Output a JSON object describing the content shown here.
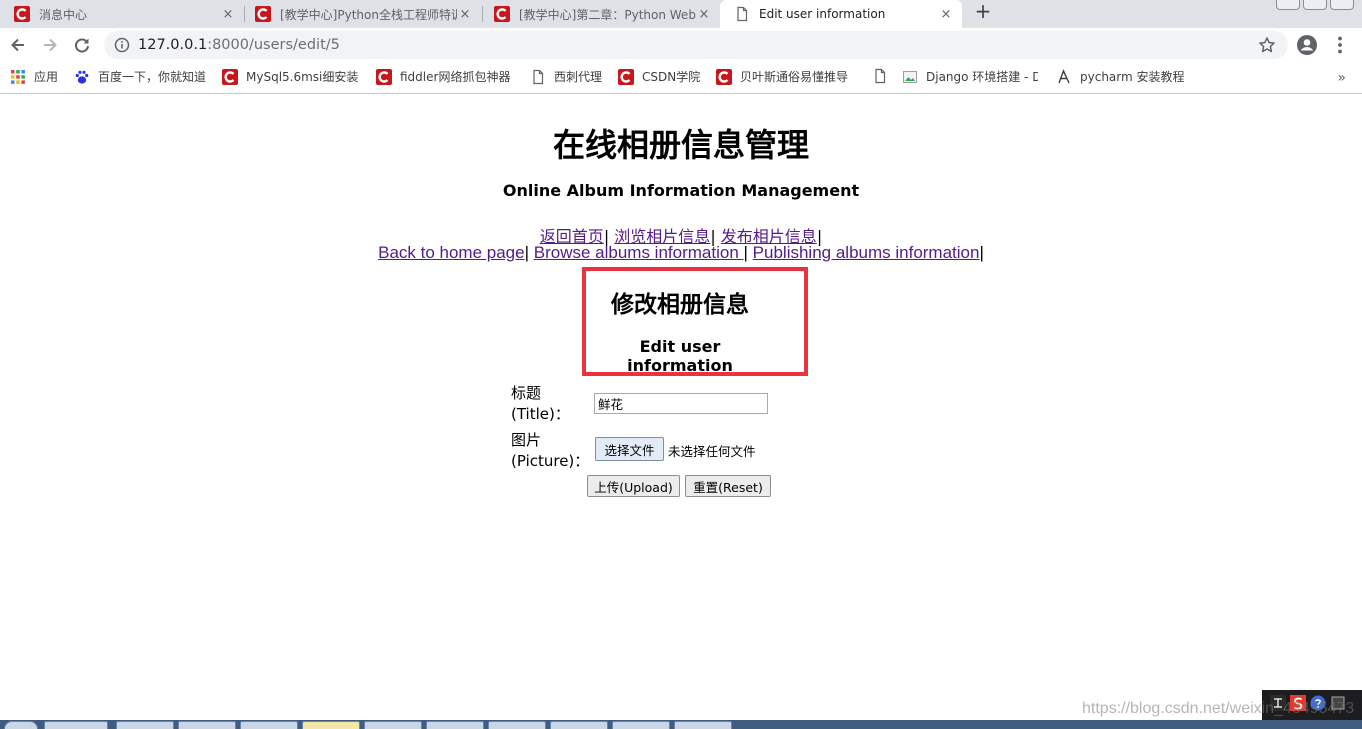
{
  "browser": {
    "tabs": [
      {
        "title": "消息中心",
        "close": "×",
        "icon": "csdn-c-icon"
      },
      {
        "title": "[教学中心]Python全栈工程师特训",
        "close": "×",
        "icon": "csdn-c-icon"
      },
      {
        "title": "[教学中心]第二章：Python Web",
        "close": "×",
        "icon": "csdn-c-icon"
      },
      {
        "title": "Edit user information",
        "close": "×",
        "icon": "document-icon"
      }
    ],
    "new_tab": "+",
    "url_host": "127.0.0.1",
    "url_path": ":8000/users/edit/5",
    "bookmarks": [
      {
        "label": "应用",
        "icon": "apps-grid-icon"
      },
      {
        "label": "百度一下，你就知道",
        "icon": "baidu-paw-icon"
      },
      {
        "label": "MySql5.6msi细安装",
        "icon": "csdn-c-icon"
      },
      {
        "label": "fiddler网络抓包神器",
        "icon": "csdn-c-icon"
      },
      {
        "label": "西刺代理",
        "icon": "document-icon"
      },
      {
        "label": "CSDN学院",
        "icon": "csdn-c-icon"
      },
      {
        "label": "贝叶斯通俗易懂推导",
        "icon": "csdn-c-icon"
      },
      {
        "label": "",
        "icon": "document-icon"
      },
      {
        "label": "Django 环境搭建 - D",
        "icon": "image-icon"
      },
      {
        "label": "pycharm 安装教程",
        "icon": "pycharm-icon"
      }
    ],
    "bookmarks_more": "»"
  },
  "page": {
    "title_cn": "在线相册信息管理",
    "title_en": "Online Album Information Management",
    "nav_cn": [
      {
        "label": "返回首页"
      },
      {
        "label": "浏览相片信息"
      },
      {
        "label": "发布相片信息"
      }
    ],
    "nav_en": [
      {
        "label": "Back to home page"
      },
      {
        "label": "Browse albums information "
      },
      {
        "label": "Publishing albums information"
      }
    ],
    "separator": "|",
    "section_cn": "修改相册信息",
    "section_en": "Edit user information",
    "form": {
      "title_label_cn": "标题",
      "title_label_en": "(Title)：",
      "title_value": "鲜花",
      "picture_label_cn": "图片",
      "picture_label_en": "(Picture)：",
      "file_button": "选择文件",
      "file_status": "未选择任何文件",
      "upload_button": "上传(Upload)",
      "reset_button": "重置(Reset)"
    }
  },
  "watermark": "https://blog.csdn.net/weixin_43495473",
  "colors": {
    "tabstrip": "#dee1e6",
    "highlight_box": "#e7343f",
    "visited_link": "#551a8b",
    "csdn_red": "#c8161d"
  }
}
